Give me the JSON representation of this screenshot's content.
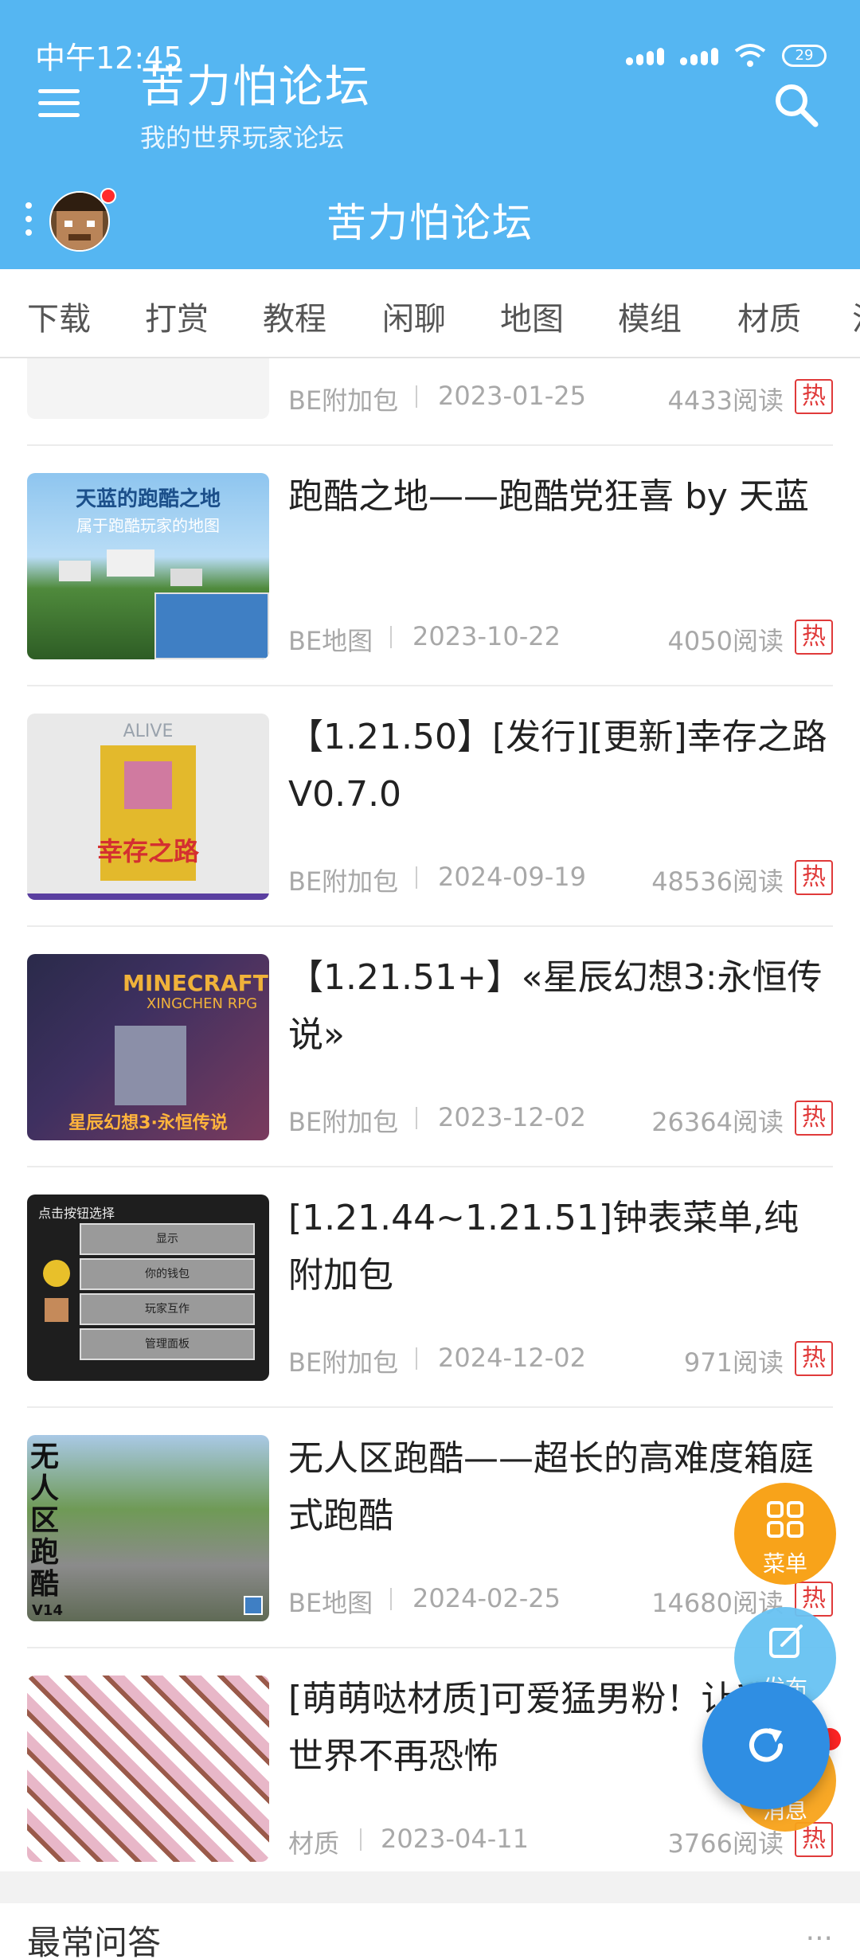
{
  "status": {
    "time": "中午12:45",
    "battery": "29"
  },
  "app": {
    "title": "苦力怕论坛",
    "subtitle": "我的世界玩家论坛"
  },
  "forum": {
    "title": "苦力怕论坛"
  },
  "tabs": [
    "下载",
    "打赏",
    "教程",
    "闲聊",
    "地图",
    "模组",
    "材质",
    "活"
  ],
  "posts": [
    {
      "title": "",
      "category": "BE附加包",
      "date": "2023-01-25",
      "reads": "4433阅读",
      "hot": "热"
    },
    {
      "title": "跑酷之地——跑酷党狂喜 by 天蓝",
      "category": "BE地图",
      "date": "2023-10-22",
      "reads": "4050阅读",
      "hot": "热",
      "thumb_text": "天蓝的跑酷之地",
      "thumb_sub": "属于跑酷玩家的地图"
    },
    {
      "title": "【1.21.50】[发行][更新]幸存之路 V0.7.0",
      "category": "BE附加包",
      "date": "2024-09-19",
      "reads": "48536阅读",
      "hot": "热",
      "thumb_text": "ALIVE",
      "thumb_sub": "幸存之路"
    },
    {
      "title": "【1.21.51+】«星辰幻想3:永恒传说»",
      "category": "BE附加包",
      "date": "2023-12-02",
      "reads": "26364阅读",
      "hot": "热",
      "thumb_text": "MINECRAFT",
      "thumb_sub": "XINGCHEN RPG",
      "thumb_caption": "星辰幻想3·永恒传说"
    },
    {
      "title": "[1.21.44~1.21.51]钟表菜单,纯附加包",
      "category": "BE附加包",
      "date": "2024-12-02",
      "reads": "971阅读",
      "hot": "热",
      "thumb_text": "点击按钮选择",
      "thumb_buttons": [
        "显示",
        "你的钱包",
        "玩家互作",
        "管理面板"
      ]
    },
    {
      "title": "无人区跑酷——超长的高难度箱庭式跑酷",
      "category": "BE地图",
      "date": "2024-02-25",
      "reads": "14680阅读",
      "hot": "热",
      "thumb_text": "无人区跑酷",
      "thumb_sub": "V14"
    },
    {
      "title": "[萌萌哒材质]可爱猛男粉！让我的世界不再恐怖",
      "category": "材质",
      "date": "2023-04-11",
      "reads": "3766阅读",
      "hot": "热"
    }
  ],
  "section": {
    "title": "最常问答",
    "more": "···"
  },
  "fabs": {
    "menu": "菜单",
    "post": "发布",
    "message": "消息"
  },
  "colors": {
    "primary": "#55b6f2",
    "fab_orange": "#f8a31a",
    "fab_blue": "#2f8ee3",
    "hot_red": "#e03a3a"
  }
}
